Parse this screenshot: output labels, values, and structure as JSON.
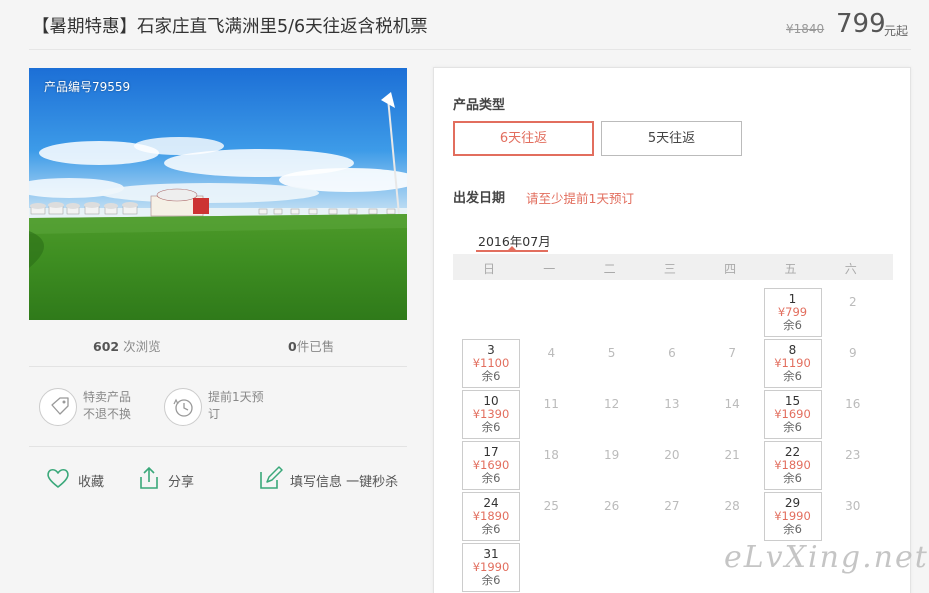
{
  "header": {
    "title": "【暑期特惠】石家庄直飞满洲里5/6天往返含税机票",
    "original_price": "¥1840",
    "price": "799",
    "price_unit": "元起"
  },
  "photo": {
    "product_no": "产品编号79559"
  },
  "stats": [
    {
      "count": "602",
      "label": "次浏览"
    },
    {
      "count": "0",
      "label": "件已售"
    }
  ],
  "features": [
    {
      "line1": "特卖产品",
      "line2": "不退不换"
    },
    {
      "line1": "提前1天预",
      "line2": "订"
    }
  ],
  "actions": [
    {
      "label": "收藏",
      "icon": "heart-icon"
    },
    {
      "label": "分享",
      "icon": "share-icon"
    },
    {
      "label": "填写信息 一键秒杀",
      "icon": "edit-icon"
    }
  ],
  "product_type": {
    "label": "产品类型",
    "options": [
      {
        "label": "6天往返",
        "selected": true
      },
      {
        "label": "5天往返",
        "selected": false
      }
    ]
  },
  "departure": {
    "label": "出发日期",
    "note": "请至少提前1天预订",
    "month": "2016年07月",
    "weekdays": [
      "日",
      "一",
      "二",
      "三",
      "四",
      "五",
      "六"
    ],
    "days": [
      {
        "d": "1",
        "col": 5,
        "row": 0,
        "price": "¥799",
        "remain": "余6"
      },
      {
        "d": "2",
        "col": 6,
        "row": 0
      },
      {
        "d": "3",
        "col": 0,
        "row": 1,
        "price": "¥1100",
        "remain": "余6"
      },
      {
        "d": "4",
        "col": 1,
        "row": 1
      },
      {
        "d": "5",
        "col": 2,
        "row": 1
      },
      {
        "d": "6",
        "col": 3,
        "row": 1
      },
      {
        "d": "7",
        "col": 4,
        "row": 1
      },
      {
        "d": "8",
        "col": 5,
        "row": 1,
        "price": "¥1190",
        "remain": "余6"
      },
      {
        "d": "9",
        "col": 6,
        "row": 1
      },
      {
        "d": "10",
        "col": 0,
        "row": 2,
        "price": "¥1390",
        "remain": "余6"
      },
      {
        "d": "11",
        "col": 1,
        "row": 2
      },
      {
        "d": "12",
        "col": 2,
        "row": 2
      },
      {
        "d": "13",
        "col": 3,
        "row": 2
      },
      {
        "d": "14",
        "col": 4,
        "row": 2
      },
      {
        "d": "15",
        "col": 5,
        "row": 2,
        "price": "¥1690",
        "remain": "余6"
      },
      {
        "d": "16",
        "col": 6,
        "row": 2
      },
      {
        "d": "17",
        "col": 0,
        "row": 3,
        "price": "¥1690",
        "remain": "余6"
      },
      {
        "d": "18",
        "col": 1,
        "row": 3
      },
      {
        "d": "19",
        "col": 2,
        "row": 3
      },
      {
        "d": "20",
        "col": 3,
        "row": 3
      },
      {
        "d": "21",
        "col": 4,
        "row": 3
      },
      {
        "d": "22",
        "col": 5,
        "row": 3,
        "price": "¥1890",
        "remain": "余6"
      },
      {
        "d": "23",
        "col": 6,
        "row": 3
      },
      {
        "d": "24",
        "col": 0,
        "row": 4,
        "price": "¥1890",
        "remain": "余6"
      },
      {
        "d": "25",
        "col": 1,
        "row": 4
      },
      {
        "d": "26",
        "col": 2,
        "row": 4
      },
      {
        "d": "27",
        "col": 3,
        "row": 4
      },
      {
        "d": "28",
        "col": 4,
        "row": 4
      },
      {
        "d": "29",
        "col": 5,
        "row": 4,
        "price": "¥1990",
        "remain": "余6"
      },
      {
        "d": "30",
        "col": 6,
        "row": 4
      },
      {
        "d": "31",
        "col": 0,
        "row": 5,
        "price": "¥1990",
        "remain": "余6"
      }
    ]
  },
  "watermark": "eLvXing.net",
  "colors": {
    "accent": "#e26e5e",
    "icon_green": "#3aa87a"
  }
}
